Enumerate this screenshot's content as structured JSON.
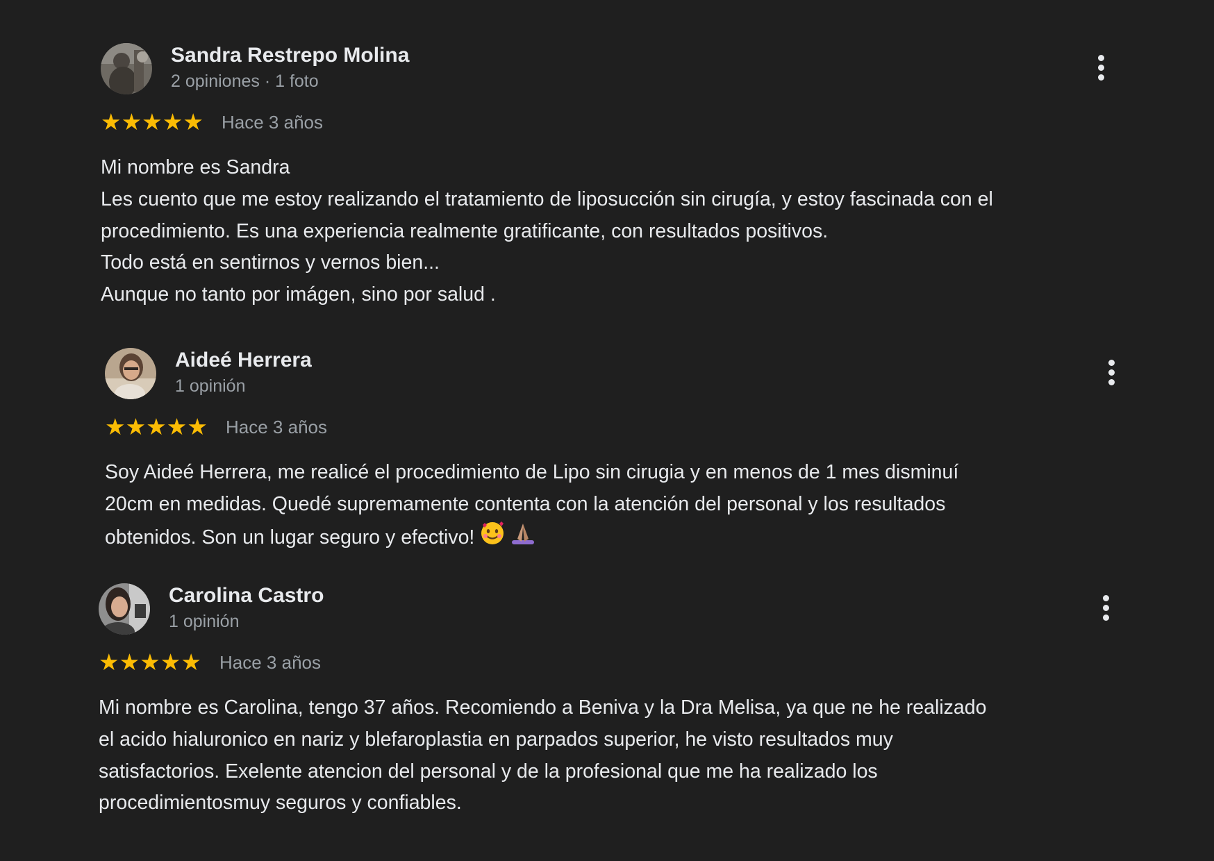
{
  "reviews": [
    {
      "name": "Sandra Restrepo Molina",
      "meta": "2 opiniones · 1 foto",
      "stars": "★★★★★",
      "rating": 5,
      "date": "Hace 3 años",
      "lines": [
        "Mi nombre es Sandra",
        "Les cuento que me estoy realizando el tratamiento de liposucción sin cirugía, y estoy fascinada con el",
        "procedimiento. Es una experiencia realmente gratificante, con resultados positivos.",
        "Todo está en sentirnos y vernos bien...",
        "Aunque no tanto por imágen, sino por salud ."
      ]
    },
    {
      "name": "Aideé Herrera",
      "meta": "1 opinión",
      "stars": "★★★★★",
      "rating": 5,
      "date": "Hace 3 años",
      "lines": [
        "Soy Aideé Herrera, me realicé el procedimiento de Lipo sin cirugia y en menos de 1 mes disminuí",
        "20cm en medidas. Quedé supremamente contenta con la atención del personal y los resultados",
        "obtenidos. Son un lugar seguro y efectivo!"
      ],
      "emojis": [
        "smiling-face-with-hearts",
        "folded-hands"
      ]
    },
    {
      "name": "Carolina Castro",
      "meta": "1 opinión",
      "stars": "★★★★★",
      "rating": 5,
      "date": "Hace 3 años",
      "lines": [
        "Mi nombre es Carolina, tengo 37 años. Recomiendo a Beniva y la Dra Melisa, ya que ne he realizado",
        "el acido hialuronico en nariz y blefaroplastia en parpados superior, he visto resultados muy",
        "satisfactorios. Exelente atencion del personal y de la profesional que me ha realizado los",
        "procedimientosmuy seguros y confiables."
      ]
    }
  ],
  "colors": {
    "background": "#1f1f1f",
    "text": "#e8eaed",
    "muted": "#9aa0a6",
    "star": "#fbbc04"
  }
}
